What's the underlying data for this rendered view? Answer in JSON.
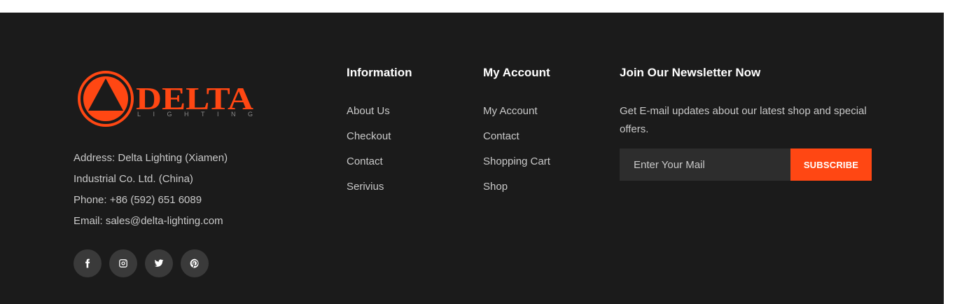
{
  "brand": {
    "logo_text": "DELTA",
    "logo_subtext": "LIGHTING",
    "color": "#ff4713"
  },
  "contact": {
    "address_line1": "Address: Delta Lighting (Xiamen)",
    "address_line2": "Industrial Co. Ltd. (China)",
    "phone": "Phone: +86 (592) 651 6089",
    "email": "Email: sales@delta-lighting.com"
  },
  "social": [
    {
      "icon": "facebook-icon"
    },
    {
      "icon": "instagram-icon"
    },
    {
      "icon": "twitter-icon"
    },
    {
      "icon": "pinterest-icon"
    }
  ],
  "information": {
    "title": "Information",
    "links": [
      "About Us",
      "Checkout",
      "Contact",
      "Serivius"
    ]
  },
  "account": {
    "title": "My Account",
    "links": [
      "My Account",
      "Contact",
      "Shopping Cart",
      "Shop"
    ]
  },
  "newsletter": {
    "title": "Join Our Newsletter Now",
    "text": "Get E-mail updates about our latest shop and special offers.",
    "placeholder": "Enter Your Mail",
    "button_label": "SUBSCRIBE"
  },
  "colors": {
    "footer_bg": "#1b1b1b",
    "accent": "#ff4713",
    "input_bg": "#2d2d2d"
  }
}
